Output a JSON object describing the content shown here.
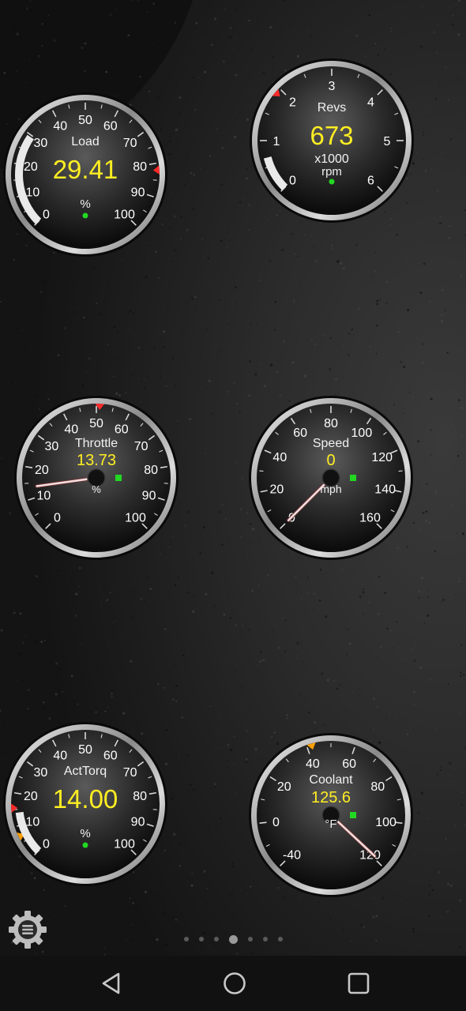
{
  "theme": {
    "value_color": "#ffee22",
    "needle_color": "#f4dede",
    "marker_red": "#ff2a2a",
    "marker_orange": "#ffa000",
    "indicator_green": "#22d822"
  },
  "gauges": [
    {
      "id": "load",
      "label": "Load",
      "value": "29.41",
      "unit": "%",
      "scale": [
        "0",
        "10",
        "20",
        "30",
        "40",
        "50",
        "60",
        "70",
        "80",
        "90",
        "100"
      ],
      "min": 0,
      "max": 100,
      "reading": 29.41,
      "style": "arc",
      "red_marker_at": 82
    },
    {
      "id": "revs",
      "label": "Revs",
      "value": "673",
      "unit": "rpm",
      "multiplier": "x1000",
      "scale": [
        "0",
        "1",
        "2",
        "3",
        "4",
        "5",
        "6"
      ],
      "min": 0,
      "max": 6,
      "reading": 0.673,
      "style": "arc",
      "red_marker_at": 1.9
    },
    {
      "id": "throttle",
      "label": "Throttle",
      "value": "13.73",
      "unit": "%",
      "scale": [
        "0",
        "10",
        "20",
        "30",
        "40",
        "50",
        "60",
        "70",
        "80",
        "90",
        "100"
      ],
      "min": 0,
      "max": 100,
      "reading": 13.73,
      "style": "needle",
      "red_marker_at": 51
    },
    {
      "id": "speed",
      "label": "Speed",
      "value": "0",
      "unit": "mph",
      "scale": [
        "0",
        "20",
        "40",
        "60",
        "80",
        "100",
        "120",
        "140",
        "160"
      ],
      "min": 0,
      "max": 160,
      "reading": 0,
      "style": "needle"
    },
    {
      "id": "acttorq",
      "label": "ActTorq",
      "value": "14.00",
      "unit": "%",
      "scale": [
        "0",
        "10",
        "20",
        "30",
        "40",
        "50",
        "60",
        "70",
        "80",
        "90",
        "100"
      ],
      "min": 0,
      "max": 100,
      "reading": 14.0,
      "style": "arc",
      "red_marker_at": 15.5,
      "orange_marker_at": 7
    },
    {
      "id": "coolant",
      "label": "Coolant",
      "value": "125.6",
      "unit": "°F",
      "scale": [
        "-40",
        "0",
        "20",
        "40",
        "60",
        "80",
        "100",
        "120"
      ],
      "scale_positions": [
        0,
        1,
        2,
        3,
        4,
        5,
        6,
        7
      ],
      "min": 0,
      "max": 7,
      "reading": 6.95,
      "style": "needle",
      "orange_marker_at": 3.1
    }
  ],
  "pager": {
    "count": 7,
    "active": 3
  },
  "icons": {
    "settings": "gear-menu-icon",
    "back": "back-triangle-icon",
    "home": "home-circle-icon",
    "recents": "recents-square-icon"
  }
}
